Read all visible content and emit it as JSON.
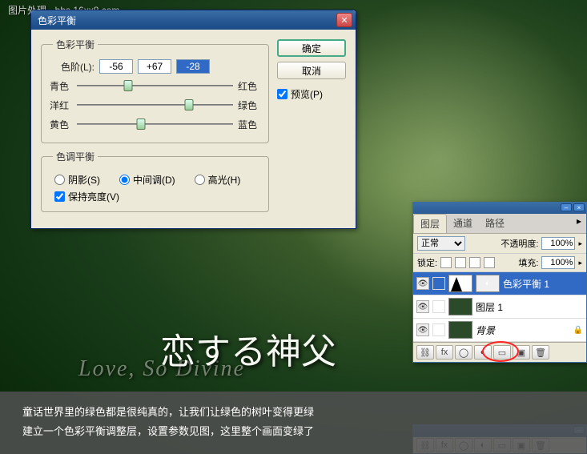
{
  "watermark": "图片处理 · bbs.16xx8.com",
  "dialog": {
    "title": "色彩平衡",
    "group1_legend": "色彩平衡",
    "levels_label": "色阶(L):",
    "levels": {
      "a": "-56",
      "b": "+67",
      "c": "-28"
    },
    "sliders": [
      {
        "left": "青色",
        "right": "红色",
        "pos": 33
      },
      {
        "left": "洋红",
        "right": "绿色",
        "pos": 72
      },
      {
        "left": "黄色",
        "right": "蓝色",
        "pos": 41
      }
    ],
    "group2_legend": "色调平衡",
    "tone": {
      "shadows": "阴影(S)",
      "midtones": "中间调(D)",
      "highlights": "高光(H)"
    },
    "preserve_luma": "保持亮度(V)",
    "ok": "确定",
    "cancel": "取消",
    "preview": "预览(P)"
  },
  "photo": {
    "title": "恋する神父",
    "subtitle": "Love, So Divine"
  },
  "panel": {
    "tabs": {
      "layers": "图层",
      "channels": "通道",
      "paths": "路径"
    },
    "blend_label": "正常",
    "opacity_label": "不透明度:",
    "opacity_value": "100%",
    "lock_label": "锁定:",
    "fill_label": "填充:",
    "fill_value": "100%",
    "layers": [
      {
        "name": "色彩平衡 1",
        "kind": "adj",
        "selected": true
      },
      {
        "name": "图层 1",
        "kind": "img",
        "selected": false
      },
      {
        "name": "背景",
        "kind": "img",
        "locked": true,
        "italic": true,
        "selected": false
      }
    ],
    "foot_icons": [
      "link-icon",
      "fx-icon",
      "mask-icon",
      "adjust-icon",
      "folder-icon",
      "new-layer-icon",
      "trash-icon"
    ]
  },
  "caption": {
    "line1": "童话世界里的绿色都是很纯真的，让我们让绿色的树叶变得更绿",
    "line2": "建立一个色彩平衡调整层，设置参数见图，这里整个画面变绿了"
  }
}
